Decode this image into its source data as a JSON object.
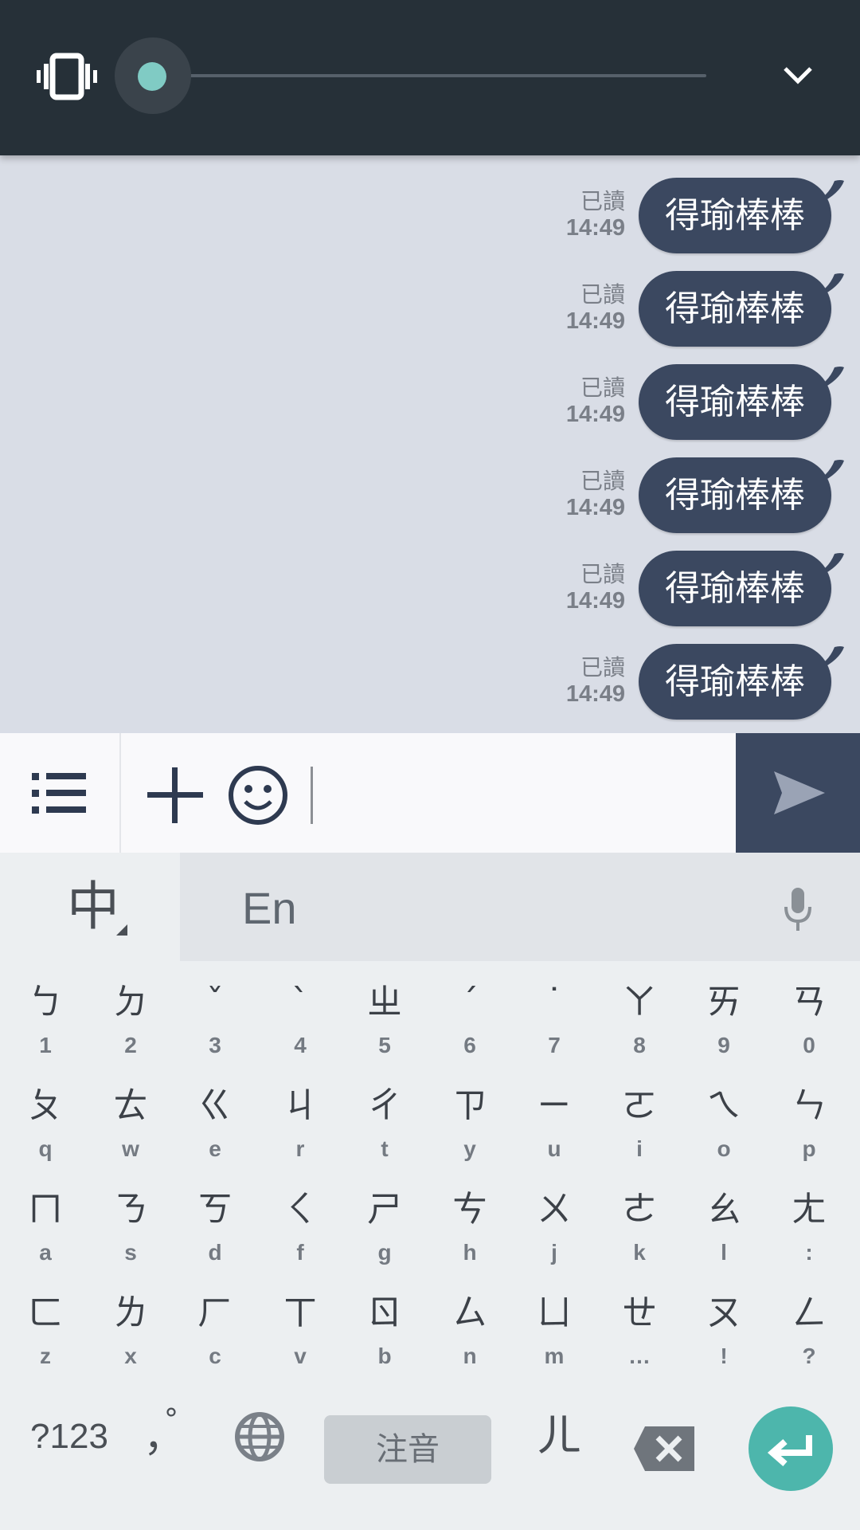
{
  "volume_panel": {
    "level_fraction": 0.0,
    "vibrate_icon": "vibrate-icon",
    "expand_icon": "chevron-down-icon"
  },
  "chat": {
    "messages": [
      {
        "read": "已讀",
        "time": "14:49",
        "text": "得瑜棒棒"
      },
      {
        "read": "已讀",
        "time": "14:49",
        "text": "得瑜棒棒"
      },
      {
        "read": "已讀",
        "time": "14:49",
        "text": "得瑜棒棒"
      },
      {
        "read": "已讀",
        "time": "14:49",
        "text": "得瑜棒棒"
      },
      {
        "read": "已讀",
        "time": "14:49",
        "text": "得瑜棒棒"
      },
      {
        "read": "已讀",
        "time": "14:49",
        "text": "得瑜棒棒"
      }
    ],
    "bubble_color": "#3b4860"
  },
  "input_bar": {
    "menu_icon": "list-icon",
    "plus_icon": "plus-icon",
    "emoji_icon": "smiley-icon",
    "send_icon": "send-icon",
    "value": ""
  },
  "keyboard": {
    "tab_zh": "中",
    "tab_en": "En",
    "mic_icon": "mic-icon",
    "rows": [
      [
        [
          "ㄅ",
          "1"
        ],
        [
          "ㄉ",
          "2"
        ],
        [
          "ˇ",
          "3"
        ],
        [
          "ˋ",
          "4"
        ],
        [
          "ㄓ",
          "5"
        ],
        [
          "ˊ",
          "6"
        ],
        [
          "˙",
          "7"
        ],
        [
          "ㄚ",
          "8"
        ],
        [
          "ㄞ",
          "9"
        ],
        [
          "ㄢ",
          "0"
        ]
      ],
      [
        [
          "ㄆ",
          "q"
        ],
        [
          "ㄊ",
          "w"
        ],
        [
          "ㄍ",
          "e"
        ],
        [
          "ㄐ",
          "r"
        ],
        [
          "ㄔ",
          "t"
        ],
        [
          "ㄗ",
          "y"
        ],
        [
          "ㄧ",
          "u"
        ],
        [
          "ㄛ",
          "i"
        ],
        [
          "ㄟ",
          "o"
        ],
        [
          "ㄣ",
          "p"
        ]
      ],
      [
        [
          "ㄇ",
          "a"
        ],
        [
          "ㄋ",
          "s"
        ],
        [
          "ㄎ",
          "d"
        ],
        [
          "ㄑ",
          "f"
        ],
        [
          "ㄕ",
          "g"
        ],
        [
          "ㄘ",
          "h"
        ],
        [
          "ㄨ",
          "j"
        ],
        [
          "ㄜ",
          "k"
        ],
        [
          "ㄠ",
          "l"
        ],
        [
          "ㄤ",
          ":"
        ]
      ],
      [
        [
          "ㄈ",
          "z"
        ],
        [
          "ㄌ",
          "x"
        ],
        [
          "ㄏ",
          "c"
        ],
        [
          "ㄒ",
          "v"
        ],
        [
          "ㄖ",
          "b"
        ],
        [
          "ㄙ",
          "n"
        ],
        [
          "ㄩ",
          "m"
        ],
        [
          "ㄝ",
          "…"
        ],
        [
          "ㄡ",
          "!"
        ],
        [
          "ㄥ",
          "?"
        ]
      ]
    ],
    "bottom": {
      "symbols": "?123",
      "punct": "，",
      "punct_dot": "°",
      "space": "注音",
      "er": "ㄦ",
      "globe_icon": "globe-icon",
      "backspace_icon": "backspace-icon",
      "enter_icon": "enter-icon"
    },
    "accent_color": "#4db6ac"
  }
}
